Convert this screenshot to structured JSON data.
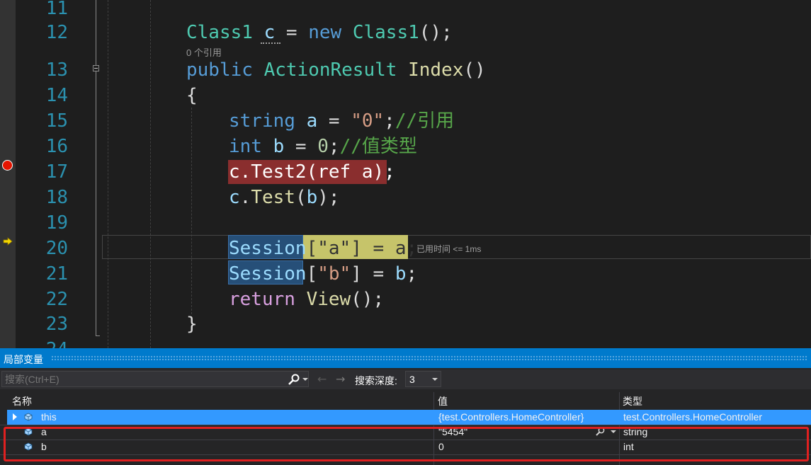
{
  "editor": {
    "line_numbers": [
      "11",
      "12",
      "13",
      "14",
      "15",
      "16",
      "17",
      "18",
      "19",
      "20",
      "21",
      "22",
      "23",
      "24"
    ],
    "references_label": "0 个引用",
    "perf_tip": "已用时间 <= 1ms",
    "lines": {
      "l12": {
        "class1a": "Class1",
        "var_c": "c",
        "eq": " = ",
        "new": "new",
        "class1b": "Class1",
        "tail": "();"
      },
      "l13": {
        "public": "public",
        "actionresult": "ActionResult",
        "index": "Index",
        "parens": "()"
      },
      "l14": {
        "brace": "{"
      },
      "l15": {
        "string": "string",
        "var": "a",
        "eq": " = ",
        "val": "\"0\"",
        "semi": ";",
        "comment": "//引用"
      },
      "l16": {
        "int": "int",
        "var": "b",
        "eq": " = ",
        "val": "0",
        "semi": ";",
        "comment": "//值类型"
      },
      "l17": {
        "text": "c.Test2(ref a);"
      },
      "l18": {
        "obj": "c",
        "dot": ".",
        "method": "Test",
        "open": "(",
        "arg": "b",
        "close": ");"
      },
      "l20": {
        "session": "Session",
        "open": "[",
        "key": "\"a\"",
        "rest": "] = a;"
      },
      "l21": {
        "session": "Session",
        "open": "[",
        "key": "\"b\"",
        "close": "]",
        "eq": " = ",
        "var": "b",
        "semi": ";"
      },
      "l22": {
        "return": "return",
        "view": "View",
        "tail": "();"
      },
      "l23": {
        "brace": "}"
      }
    }
  },
  "locals": {
    "title": "局部变量",
    "search_placeholder": "搜索(Ctrl+E)",
    "depth_label": "搜索深度:",
    "depth_value": "3",
    "columns": {
      "name": "名称",
      "value": "值",
      "type": "类型"
    },
    "rows": [
      {
        "name": "this",
        "value": "{test.Controllers.HomeController}",
        "type": "test.Controllers.HomeController"
      },
      {
        "name": "a",
        "value": "\"5454\"",
        "type": "string"
      },
      {
        "name": "b",
        "value": "0",
        "type": "int"
      }
    ]
  },
  "colors": {
    "breakpoint": "#e51400",
    "breakpoint_line": "#8a2e2e",
    "current_statement": "#c6c46a",
    "selection": "#3399ff",
    "pane_title": "#007acc",
    "annotation_frame": "#e02020"
  }
}
